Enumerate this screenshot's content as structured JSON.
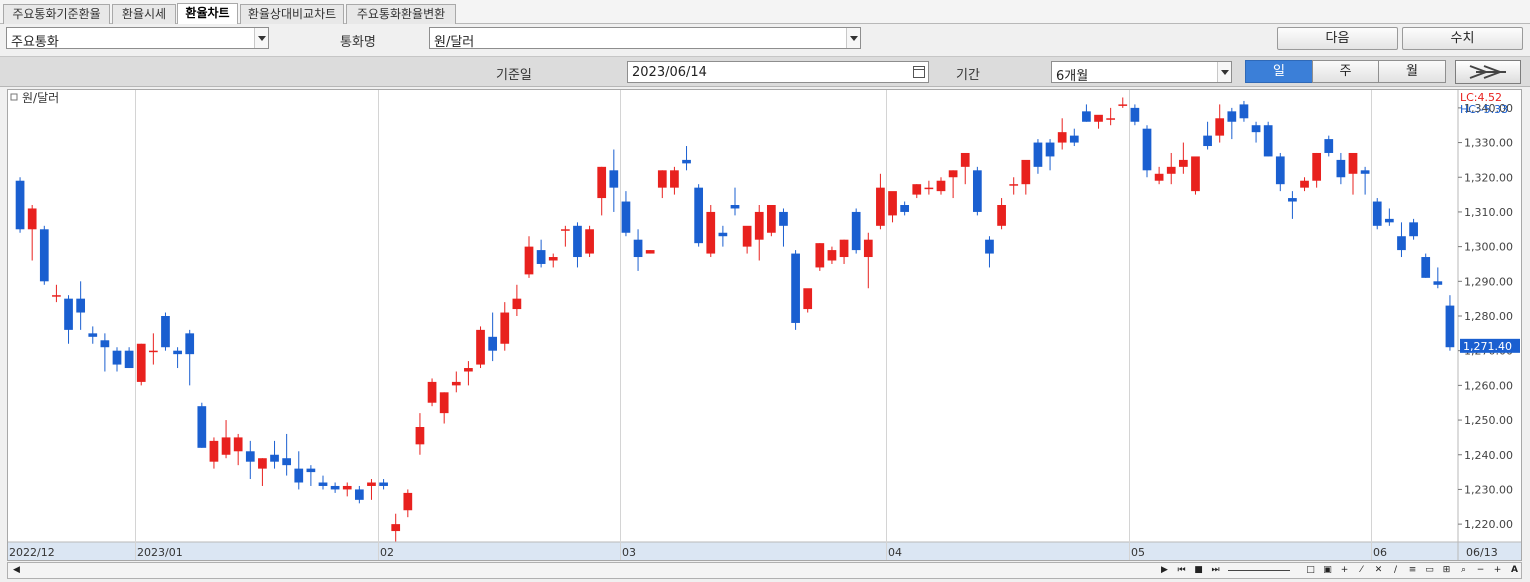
{
  "tabs": [
    {
      "label": "주요통화기준환율",
      "active": false
    },
    {
      "label": "환율시세",
      "active": false
    },
    {
      "label": "환율차트",
      "active": true
    },
    {
      "label": "환율상대비교차트",
      "active": false
    },
    {
      "label": "주요통화환율변환",
      "active": false
    }
  ],
  "filters": {
    "group_value": "주요통화",
    "currency_label": "통화명",
    "currency_value": "원/달러",
    "date_label": "기준일",
    "date_value": "2023/06/14",
    "period_label": "기간",
    "period_value": "6개월"
  },
  "buttons": {
    "next": "다음",
    "value": "수치"
  },
  "interval_tabs": [
    {
      "label": "일",
      "active": true
    },
    {
      "label": "주",
      "active": false
    },
    {
      "label": "월",
      "active": false
    }
  ],
  "colors": {
    "up": "#e8211e",
    "down": "#1a5fd0",
    "accent": "#3b7fd8"
  },
  "chart_data": {
    "type": "candlestick",
    "series_label": "원/달러",
    "lc": "LC:4.52",
    "hc": "HC:-5.33",
    "current_value": "1,271.40",
    "y_ticks": [
      "1,340.00",
      "1,330.00",
      "1,320.00",
      "1,310.00",
      "1,300.00",
      "1,290.00",
      "1,280.00",
      "1,270.00",
      "1,260.00",
      "1,250.00",
      "1,240.00",
      "1,230.00",
      "1,220.00"
    ],
    "ylim": [
      1216,
      1344
    ],
    "x_labels": [
      "2022/12",
      "2023/01",
      "02",
      "03",
      "04",
      "05",
      "06",
      "06/13"
    ],
    "grid": true,
    "candles": [
      [
        1319,
        1320,
        1304,
        1305
      ],
      [
        1305,
        1312,
        1296,
        1311
      ],
      [
        1305,
        1306,
        1289,
        1290
      ],
      [
        1286,
        1289,
        1284,
        1286
      ],
      [
        1285,
        1286,
        1272,
        1276
      ],
      [
        1285,
        1290,
        1276,
        1281
      ],
      [
        1275,
        1277,
        1272,
        1274
      ],
      [
        1273,
        1275,
        1264,
        1271
      ],
      [
        1270,
        1271,
        1264,
        1266
      ],
      [
        1270,
        1271,
        1265,
        1265
      ],
      [
        1261,
        1272,
        1260,
        1272
      ],
      [
        1270,
        1275,
        1266,
        1270
      ],
      [
        1280,
        1281,
        1270,
        1271
      ],
      [
        1270,
        1271,
        1265,
        1269
      ],
      [
        1275,
        1276,
        1260,
        1269
      ],
      [
        1254,
        1255,
        1242,
        1242
      ],
      [
        1238,
        1245,
        1236,
        1244
      ],
      [
        1240,
        1250,
        1239,
        1245
      ],
      [
        1241,
        1246,
        1237,
        1245
      ],
      [
        1241,
        1244,
        1233,
        1238
      ],
      [
        1236,
        1239,
        1231,
        1239
      ],
      [
        1240,
        1244,
        1236,
        1238
      ],
      [
        1239,
        1246,
        1234,
        1237
      ],
      [
        1236,
        1241,
        1230,
        1232
      ],
      [
        1236,
        1237,
        1231,
        1235
      ],
      [
        1232,
        1234,
        1230,
        1231
      ],
      [
        1231,
        1232,
        1229,
        1230
      ],
      [
        1230,
        1232,
        1228,
        1231
      ],
      [
        1230,
        1231,
        1226,
        1227
      ],
      [
        1231,
        1233,
        1227,
        1232
      ],
      [
        1232,
        1233,
        1230,
        1231
      ],
      [
        1218,
        1223,
        1215,
        1220
      ],
      [
        1224,
        1230,
        1222,
        1229
      ],
      [
        1243,
        1252,
        1240,
        1248
      ],
      [
        1255,
        1262,
        1254,
        1261
      ],
      [
        1252,
        1258,
        1249,
        1258
      ],
      [
        1260,
        1264,
        1258,
        1261
      ],
      [
        1264,
        1267,
        1260,
        1265
      ],
      [
        1266,
        1277,
        1265,
        1276
      ],
      [
        1274,
        1281,
        1267,
        1270
      ],
      [
        1272,
        1284,
        1270,
        1281
      ],
      [
        1282,
        1289,
        1280,
        1285
      ],
      [
        1292,
        1303,
        1291,
        1300
      ],
      [
        1299,
        1302,
        1294,
        1295
      ],
      [
        1296,
        1298,
        1294,
        1297
      ],
      [
        1305,
        1306,
        1300,
        1305
      ],
      [
        1306,
        1307,
        1294,
        1297
      ],
      [
        1298,
        1306,
        1297,
        1305
      ],
      [
        1314,
        1323,
        1309,
        1323
      ],
      [
        1322,
        1328,
        1310,
        1317
      ],
      [
        1313,
        1316,
        1303,
        1304
      ],
      [
        1302,
        1305,
        1293,
        1297
      ],
      [
        1298,
        1299,
        1298,
        1299
      ],
      [
        1317,
        1322,
        1314,
        1322
      ],
      [
        1317,
        1323,
        1315,
        1322
      ],
      [
        1325,
        1329,
        1322,
        1324
      ],
      [
        1317,
        1318,
        1300,
        1301
      ],
      [
        1298,
        1312,
        1297,
        1310
      ],
      [
        1304,
        1306,
        1300,
        1303
      ],
      [
        1312,
        1317,
        1309,
        1311
      ],
      [
        1300,
        1303,
        1298,
        1306
      ],
      [
        1302,
        1312,
        1296,
        1310
      ],
      [
        1304,
        1312,
        1303,
        1312
      ],
      [
        1310,
        1311,
        1300,
        1306
      ],
      [
        1298,
        1299,
        1276,
        1278
      ],
      [
        1282,
        1287,
        1281,
        1288
      ],
      [
        1294,
        1301,
        1293,
        1301
      ],
      [
        1296,
        1300,
        1295,
        1299
      ],
      [
        1297,
        1302,
        1295,
        1302
      ],
      [
        1310,
        1311,
        1298,
        1299
      ],
      [
        1297,
        1304,
        1288,
        1302
      ],
      [
        1306,
        1321,
        1305,
        1317
      ],
      [
        1309,
        1315,
        1307,
        1316
      ],
      [
        1312,
        1313,
        1309,
        1310
      ],
      [
        1315,
        1318,
        1314,
        1318
      ],
      [
        1317,
        1319,
        1315,
        1317
      ],
      [
        1316,
        1320,
        1315,
        1319
      ],
      [
        1320,
        1322,
        1314,
        1322
      ],
      [
        1323,
        1326,
        1318,
        1327
      ],
      [
        1322,
        1323,
        1309,
        1310
      ],
      [
        1302,
        1303,
        1294,
        1298
      ],
      [
        1306,
        1314,
        1305,
        1312
      ],
      [
        1318,
        1320,
        1315,
        1318
      ],
      [
        1318,
        1324,
        1315,
        1325
      ],
      [
        1330,
        1331,
        1321,
        1323
      ],
      [
        1330,
        1331,
        1322,
        1326
      ],
      [
        1330,
        1337,
        1328,
        1333
      ],
      [
        1332,
        1334,
        1329,
        1330
      ],
      [
        1339,
        1341,
        1336,
        1336
      ],
      [
        1336,
        1337,
        1334,
        1338
      ],
      [
        1337,
        1340,
        1335,
        1337
      ],
      [
        1341,
        1343,
        1340,
        1341
      ],
      [
        1340,
        1341,
        1335,
        1336
      ],
      [
        1334,
        1335,
        1320,
        1322
      ],
      [
        1319,
        1323,
        1318,
        1321
      ],
      [
        1321,
        1327,
        1318,
        1323
      ],
      [
        1323,
        1330,
        1321,
        1325
      ],
      [
        1316,
        1322,
        1315,
        1326
      ],
      [
        1332,
        1336,
        1328,
        1329
      ],
      [
        1332,
        1341,
        1330,
        1337
      ],
      [
        1339,
        1340,
        1331,
        1336
      ],
      [
        1341,
        1342,
        1336,
        1337
      ],
      [
        1335,
        1336,
        1330,
        1333
      ],
      [
        1335,
        1336,
        1326,
        1326
      ],
      [
        1326,
        1327,
        1316,
        1318
      ],
      [
        1314,
        1316,
        1308,
        1313
      ],
      [
        1317,
        1320,
        1316,
        1319
      ],
      [
        1319,
        1327,
        1317,
        1327
      ],
      [
        1331,
        1332,
        1326,
        1327
      ],
      [
        1325,
        1327,
        1318,
        1320
      ],
      [
        1321,
        1327,
        1315,
        1327
      ],
      [
        1322,
        1323,
        1315,
        1321
      ],
      [
        1313,
        1314,
        1305,
        1306
      ],
      [
        1308,
        1311,
        1306,
        1307
      ],
      [
        1303,
        1307,
        1297,
        1299
      ],
      [
        1307,
        1308,
        1302,
        1303
      ],
      [
        1297,
        1298,
        1291,
        1291
      ],
      [
        1290,
        1294,
        1288,
        1289
      ],
      [
        1283,
        1286,
        1270,
        1271
      ]
    ],
    "month_starts": [
      {
        "label": "2023/01",
        "index": 10
      },
      {
        "label": "02",
        "index": 30
      },
      {
        "label": "03",
        "index": 50
      },
      {
        "label": "04",
        "index": 72
      },
      {
        "label": "05",
        "index": 92
      },
      {
        "label": "06",
        "index": 112
      }
    ]
  }
}
